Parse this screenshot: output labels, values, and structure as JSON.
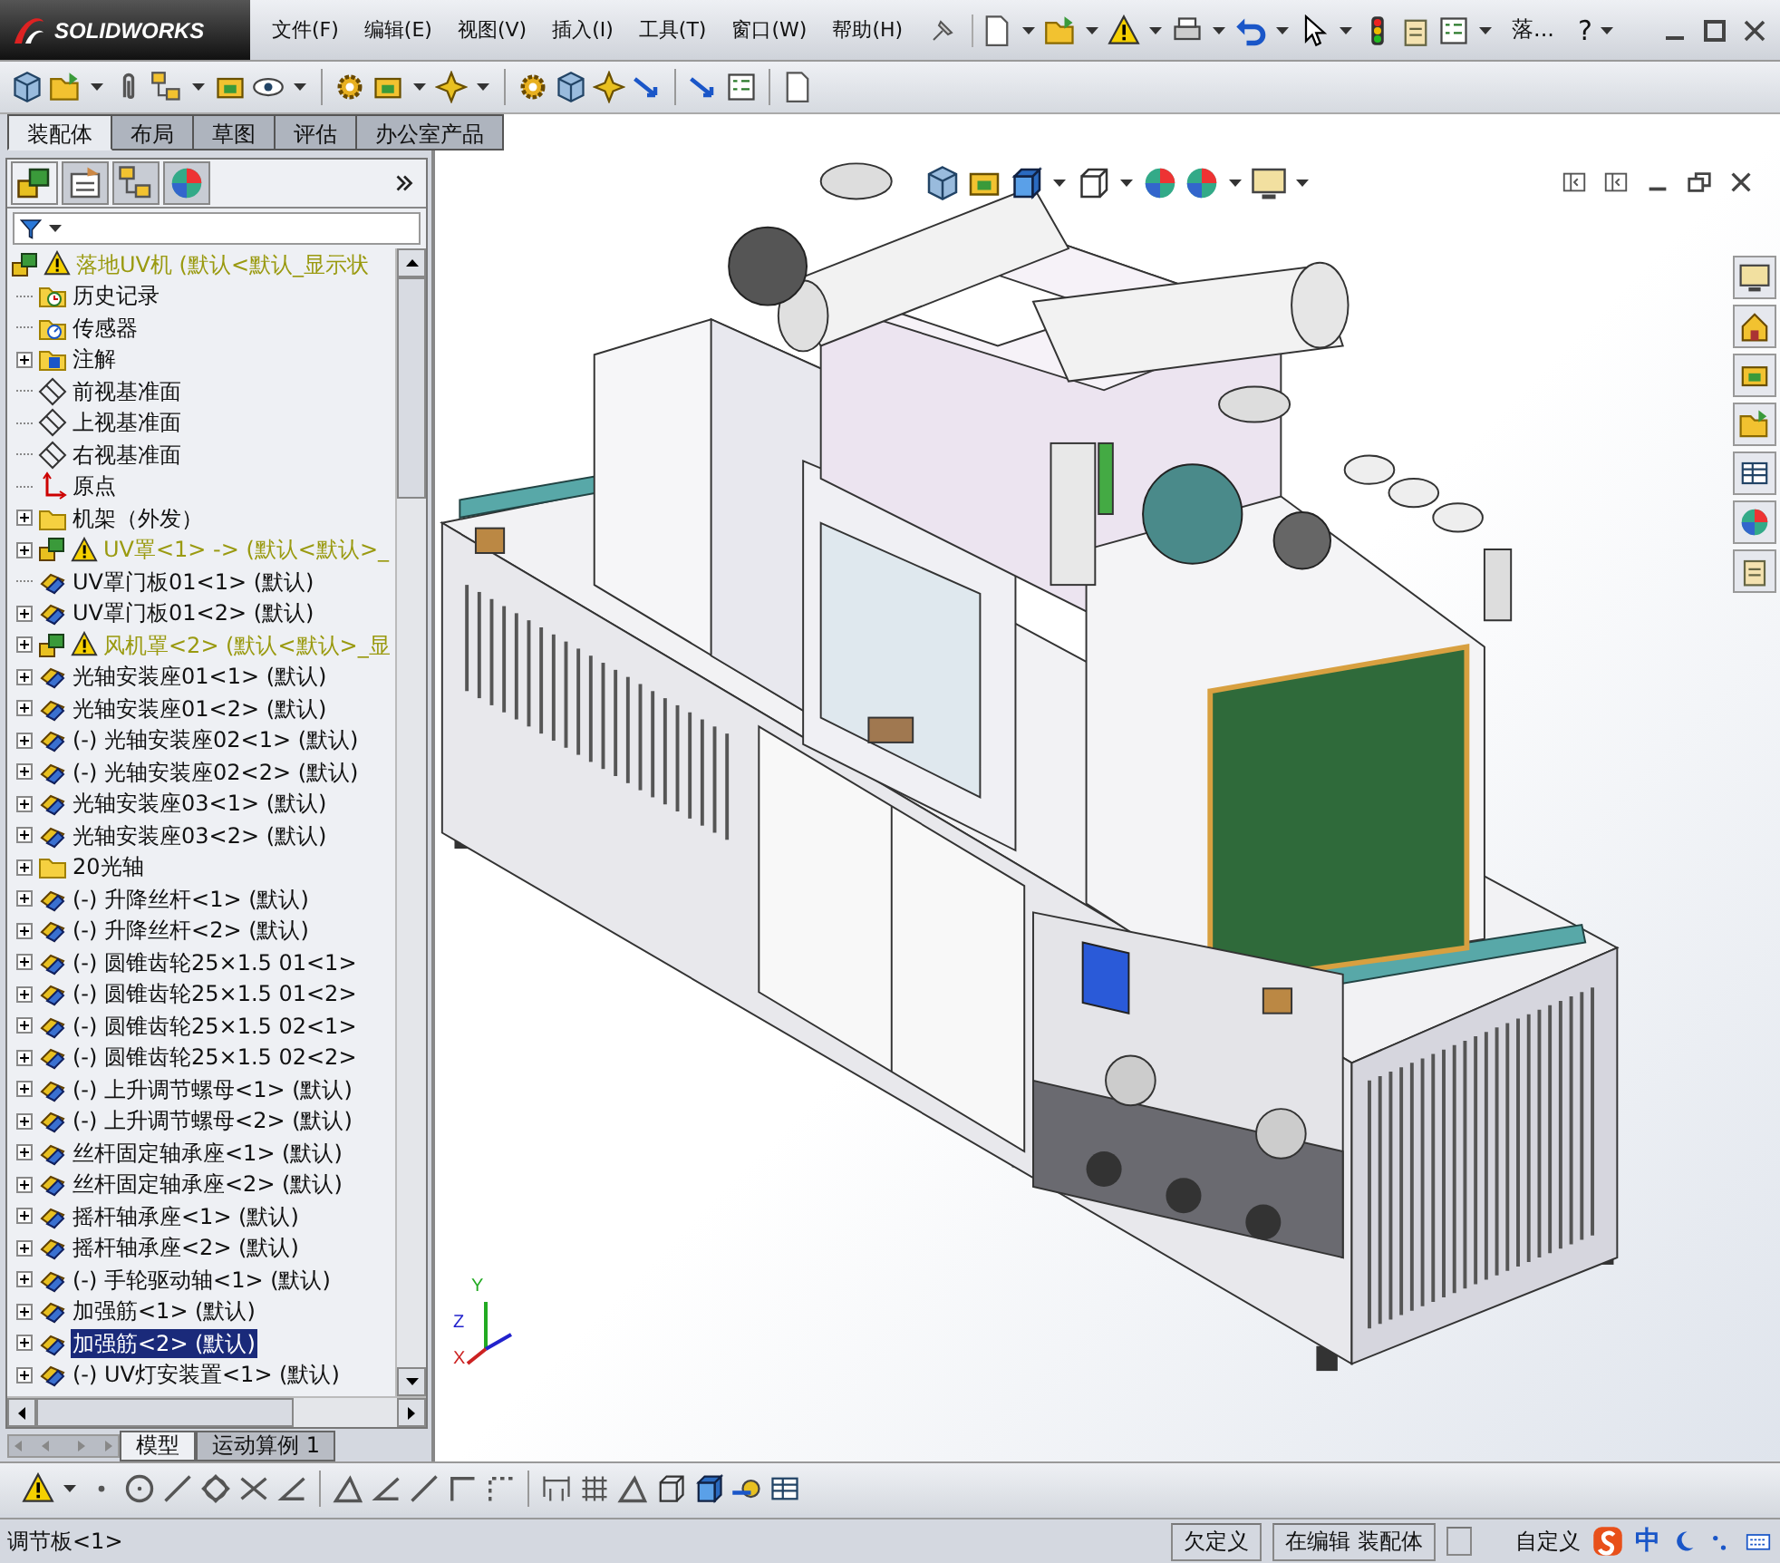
{
  "app": {
    "logo_text": "SOLIDWORKS",
    "menus": [
      "文件(F)",
      "编辑(E)",
      "视图(V)",
      "插入(I)",
      "工具(T)",
      "窗口(W)",
      "帮助(H)"
    ],
    "document_title": "落...",
    "help_glyph": "?"
  },
  "command_tabs": [
    {
      "label": "装配体",
      "selected": true
    },
    {
      "label": "布局",
      "selected": false
    },
    {
      "label": "草图",
      "selected": false
    },
    {
      "label": "评估",
      "selected": false
    },
    {
      "label": "办公室产品",
      "selected": false
    }
  ],
  "tree": {
    "root": {
      "label": "落地UV机  (默认<默认_显示状",
      "kind": "assembly",
      "warning": true,
      "selected": false,
      "children": [
        {
          "label": "历史记录",
          "kind": "history",
          "expandable": false,
          "warning": false,
          "selected": false
        },
        {
          "label": "传感器",
          "kind": "sensor",
          "expandable": false,
          "warning": false,
          "selected": false
        },
        {
          "label": "注解",
          "kind": "annotation",
          "expandable": true,
          "warning": false,
          "selected": false
        },
        {
          "label": "前视基准面",
          "kind": "plane",
          "expandable": false,
          "warning": false,
          "selected": false
        },
        {
          "label": "上视基准面",
          "kind": "plane",
          "expandable": false,
          "warning": false,
          "selected": false
        },
        {
          "label": "右视基准面",
          "kind": "plane",
          "expandable": false,
          "warning": false,
          "selected": false
        },
        {
          "label": "原点",
          "kind": "origin",
          "expandable": false,
          "warning": false,
          "selected": false
        },
        {
          "label": "机架（外发）",
          "kind": "folder",
          "expandable": true,
          "warning": false,
          "selected": false
        },
        {
          "label": "UV罩<1> -> (默认<默认>_",
          "kind": "assembly",
          "expandable": true,
          "warning": true,
          "selected": false
        },
        {
          "label": "UV罩门板01<1> (默认)",
          "kind": "part",
          "expandable": false,
          "warning": false,
          "selected": false
        },
        {
          "label": "UV罩门板01<2> (默认)",
          "kind": "part",
          "expandable": true,
          "warning": false,
          "selected": false
        },
        {
          "label": "风机罩<2> (默认<默认>_显",
          "kind": "assembly",
          "expandable": true,
          "warning": true,
          "selected": false
        },
        {
          "label": "光轴安装座01<1> (默认)",
          "kind": "part",
          "expandable": true,
          "warning": false,
          "selected": false
        },
        {
          "label": "光轴安装座01<2> (默认)",
          "kind": "part",
          "expandable": true,
          "warning": false,
          "selected": false
        },
        {
          "label": "(-) 光轴安装座02<1> (默认)",
          "kind": "part",
          "expandable": true,
          "warning": false,
          "selected": false
        },
        {
          "label": "(-) 光轴安装座02<2> (默认)",
          "kind": "part",
          "expandable": true,
          "warning": false,
          "selected": false
        },
        {
          "label": "光轴安装座03<1> (默认)",
          "kind": "part",
          "expandable": true,
          "warning": false,
          "selected": false
        },
        {
          "label": "光轴安装座03<2> (默认)",
          "kind": "part",
          "expandable": true,
          "warning": false,
          "selected": false
        },
        {
          "label": "20光轴",
          "kind": "folder",
          "expandable": true,
          "warning": false,
          "selected": false
        },
        {
          "label": "(-) 升降丝杆<1> (默认)",
          "kind": "part",
          "expandable": true,
          "warning": false,
          "selected": false
        },
        {
          "label": "(-) 升降丝杆<2> (默认)",
          "kind": "part",
          "expandable": true,
          "warning": false,
          "selected": false
        },
        {
          "label": "(-) 圆锥齿轮25×1.5 01<1>",
          "kind": "part",
          "expandable": true,
          "warning": false,
          "selected": false
        },
        {
          "label": "(-) 圆锥齿轮25×1.5 01<2>",
          "kind": "part",
          "expandable": true,
          "warning": false,
          "selected": false
        },
        {
          "label": "(-) 圆锥齿轮25×1.5 02<1>",
          "kind": "part",
          "expandable": true,
          "warning": false,
          "selected": false
        },
        {
          "label": "(-) 圆锥齿轮25×1.5 02<2>",
          "kind": "part",
          "expandable": true,
          "warning": false,
          "selected": false
        },
        {
          "label": "(-) 上升调节螺母<1> (默认)",
          "kind": "part",
          "expandable": true,
          "warning": false,
          "selected": false
        },
        {
          "label": "(-) 上升调节螺母<2> (默认)",
          "kind": "part",
          "expandable": true,
          "warning": false,
          "selected": false
        },
        {
          "label": "丝杆固定轴承座<1> (默认)",
          "kind": "part",
          "expandable": true,
          "warning": false,
          "selected": false
        },
        {
          "label": "丝杆固定轴承座<2> (默认)",
          "kind": "part",
          "expandable": true,
          "warning": false,
          "selected": false
        },
        {
          "label": "摇杆轴承座<1> (默认)",
          "kind": "part",
          "expandable": true,
          "warning": false,
          "selected": false
        },
        {
          "label": "摇杆轴承座<2> (默认)",
          "kind": "part",
          "expandable": true,
          "warning": false,
          "selected": false
        },
        {
          "label": "(-) 手轮驱动轴<1> (默认)",
          "kind": "part",
          "expandable": true,
          "warning": false,
          "selected": false
        },
        {
          "label": "加强筋<1> (默认)",
          "kind": "part",
          "expandable": true,
          "warning": false,
          "selected": false
        },
        {
          "label": "加强筋<2> (默认)",
          "kind": "part",
          "expandable": true,
          "warning": false,
          "selected": true
        },
        {
          "label": "(-) UV灯安装置<1> (默认)",
          "kind": "part",
          "expandable": true,
          "warning": false,
          "selected": false
        }
      ]
    }
  },
  "bottom_tabs": [
    {
      "label": "模型",
      "selected": true
    },
    {
      "label": "运动算例 1",
      "selected": false
    }
  ],
  "triad": {
    "x": "X",
    "y": "Y",
    "z": "Z"
  },
  "status_bar": {
    "selection": "调节板<1>",
    "definition": "欠定义",
    "mode": "在编辑 装配体",
    "units": "自定义",
    "ime": "中"
  }
}
